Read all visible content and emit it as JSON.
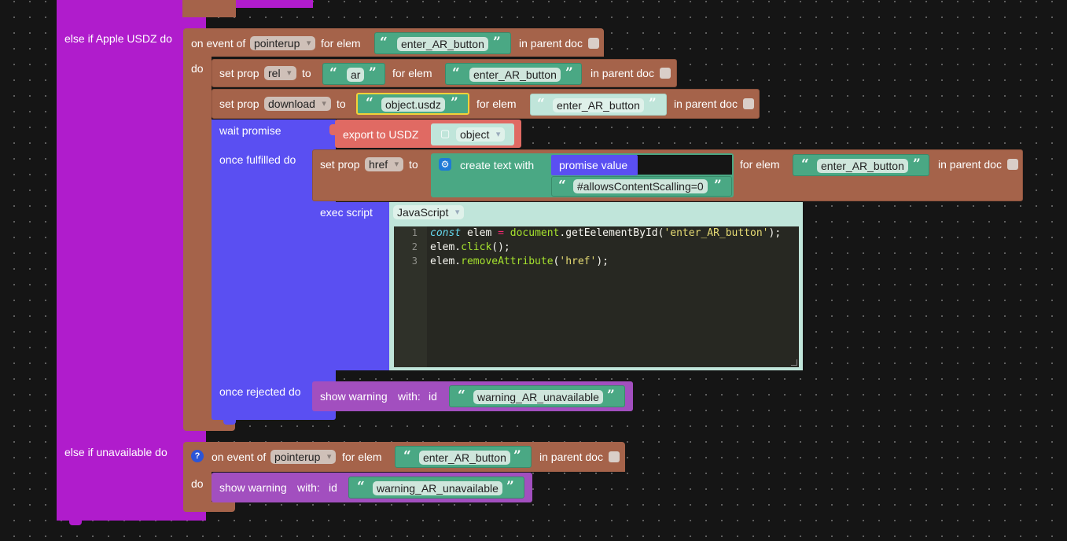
{
  "outer_if": {
    "else_if_usdz_label": "else if Apple USDZ do",
    "else_if_unavailable_label": "else if unavailable do"
  },
  "usdz_branch": {
    "on_event_label": "on event of",
    "event_dropdown": "pointerup",
    "for_elem_label": "for elem",
    "elem_id": "enter_AR_button",
    "in_parent_doc_label": "in parent doc",
    "do_label": "do",
    "set_prop_rel": {
      "label": "set prop",
      "prop": "rel",
      "to_label": "to",
      "value": "ar",
      "for_elem_label": "for elem",
      "elem_id": "enter_AR_button",
      "in_parent_doc_label": "in parent doc"
    },
    "set_prop_download": {
      "label": "set prop",
      "prop": "download",
      "to_label": "to",
      "value": "object.usdz",
      "for_elem_label": "for elem",
      "elem_id": "enter_AR_button",
      "in_parent_doc_label": "in parent doc"
    },
    "wait_promise": {
      "label": "wait promise",
      "export_label": "export to USDZ",
      "object_dropdown": "object",
      "once_fulfilled_label": "once fulfilled do",
      "once_rejected_label": "once rejected do"
    },
    "set_prop_href": {
      "label": "set prop",
      "prop": "href",
      "to_label": "to",
      "create_text_label": "create text with",
      "promise_value_label": "promise value",
      "text_item_2": "#allowsContentScalling=0",
      "for_elem_label": "for elem",
      "elem_id": "enter_AR_button",
      "in_parent_doc_label": "in parent doc"
    },
    "exec_script": {
      "label": "exec script",
      "language": "JavaScript",
      "line_numbers": [
        "1",
        "2",
        "3"
      ],
      "lines": [
        [
          {
            "t": "const",
            "c": "kw"
          },
          {
            "t": " elem ",
            "c": ""
          },
          {
            "t": "=",
            "c": "op"
          },
          {
            "t": " ",
            "c": ""
          },
          {
            "t": "document",
            "c": "fn"
          },
          {
            "t": ".getEelementById(",
            "c": ""
          },
          {
            "t": "'enter_AR_button'",
            "c": "st"
          },
          {
            "t": ");",
            "c": ""
          }
        ],
        [
          {
            "t": "elem.",
            "c": ""
          },
          {
            "t": "click",
            "c": "fn"
          },
          {
            "t": "();",
            "c": ""
          }
        ],
        [
          {
            "t": "elem.",
            "c": ""
          },
          {
            "t": "removeAttribute",
            "c": "fn"
          },
          {
            "t": "(",
            "c": ""
          },
          {
            "t": "'href'",
            "c": "st"
          },
          {
            "t": ");",
            "c": ""
          }
        ]
      ]
    },
    "show_warning": {
      "label": "show warning",
      "with_label": "with:",
      "id_label": "id",
      "value": "warning_AR_unavailable"
    }
  },
  "unavailable_branch": {
    "on_event_label": "on event of",
    "event_dropdown": "pointerup",
    "for_elem_label": "for elem",
    "elem_id": "enter_AR_button",
    "in_parent_doc_label": "in parent doc",
    "do_label": "do",
    "show_warning": {
      "label": "show warning",
      "with_label": "with:",
      "id_label": "id",
      "value": "warning_AR_unavailable"
    }
  },
  "colors": {
    "control_purple": "#b01ccc",
    "event_brown": "#a5634a",
    "promise_blue": "#5a4ff2",
    "text_green": "#4aa884",
    "script_mint": "#c0e5da",
    "warning_violet": "#a24fbf"
  }
}
